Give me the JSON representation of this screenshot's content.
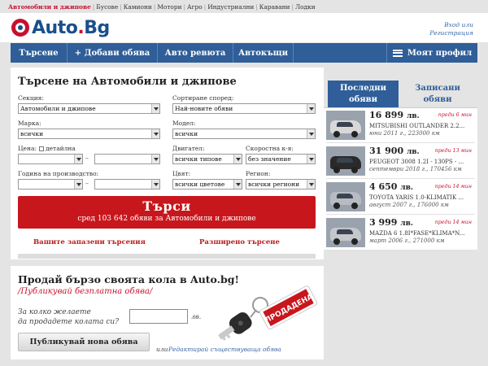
{
  "top_categories": [
    "Автомобили и джипове",
    "Бусове",
    "Камиони",
    "Мотори",
    "Агро",
    "Индустриални",
    "Каравани",
    "Лодки"
  ],
  "header": {
    "logo_main": "Auto",
    "logo_dot": ".",
    "logo_tld": "Bg",
    "login_line1": "Вход или",
    "login_line2": "Регистрация"
  },
  "nav": {
    "search": "Търсене",
    "add_ad": "+ Добави обява",
    "magazine": "Авто ревюта",
    "dealers": "Автокъщи",
    "profile": "Моят профил"
  },
  "search_panel": {
    "title": "Търсене на Автомобили и джипове",
    "section_label": "Секция:",
    "section_value": "Автомобили и джипове",
    "sort_label": "Сортиране според:",
    "sort_value": "Най-новите обяви",
    "make_label": "Марка:",
    "make_value": "всички",
    "model_label": "Модел:",
    "model_value": "всички",
    "price_label": "Цена:",
    "price_detail": "детайлна",
    "engine_label": "Двигател:",
    "engine_value": "всички типове",
    "gearbox_label": "Скоростна к-я:",
    "gearbox_value": "без значение",
    "year_label": "Година на производство:",
    "color_label": "Цвят:",
    "color_value": "всички цветове",
    "region_label": "Регион:",
    "region_value": "всички региони",
    "range_dash": "–",
    "search_button": "Търси",
    "search_count": "сред 103 642 обяви за Автомобили и джипове",
    "saved_searches": "Вашите запазени търсения",
    "advanced_search": "Разширено търсене"
  },
  "sell_panel": {
    "title": "Продай бързо своята кола в Auto.bg!",
    "subtitle": "/Публикувай безплатна обява/",
    "question_line1": "За колко желаете",
    "question_line2": "да продадете колата си?",
    "price_value": "",
    "currency": "лв.",
    "publish_button": "Публикувай нова обява",
    "or_text": "или",
    "edit_link": "Редактирай съществуваща обява",
    "tag_text": "ПРОДАДЕНА"
  },
  "right_column": {
    "tab_latest": "Последни обяви",
    "tab_saved": "Записани обяви",
    "ads": [
      {
        "price": "16 899",
        "currency": "лв.",
        "time": "преди 6 мин",
        "title": "MITSUBISHI OUTLANDER 2.2...",
        "meta": "юни 2011 г., 223000 км",
        "car_color": "#d8d8d8"
      },
      {
        "price": "31 900",
        "currency": "лв.",
        "time": "преди 13 мин",
        "title": "PEUGEOT 3008 1.2I - 130PS - ...",
        "meta": "септември 2018 г., 170456 км",
        "car_color": "#2a2a2a"
      },
      {
        "price": "4 650",
        "currency": "лв.",
        "time": "преди 14 мин",
        "title": "TOYOTA YARIS 1.0-KLIMATIK ...",
        "meta": "август 2007 г., 176000 км",
        "car_color": "#b8bcc2"
      },
      {
        "price": "3 999",
        "currency": "лв.",
        "time": "преди 14 мин",
        "title": "MAZDA 6 1.8I*FASE*KLIMA*N...",
        "meta": "март 2006 г., 271000 км",
        "car_color": "#c4c7cc"
      }
    ]
  },
  "colors": {
    "brand_blue": "#2f5e98",
    "brand_red": "#c8161d"
  }
}
